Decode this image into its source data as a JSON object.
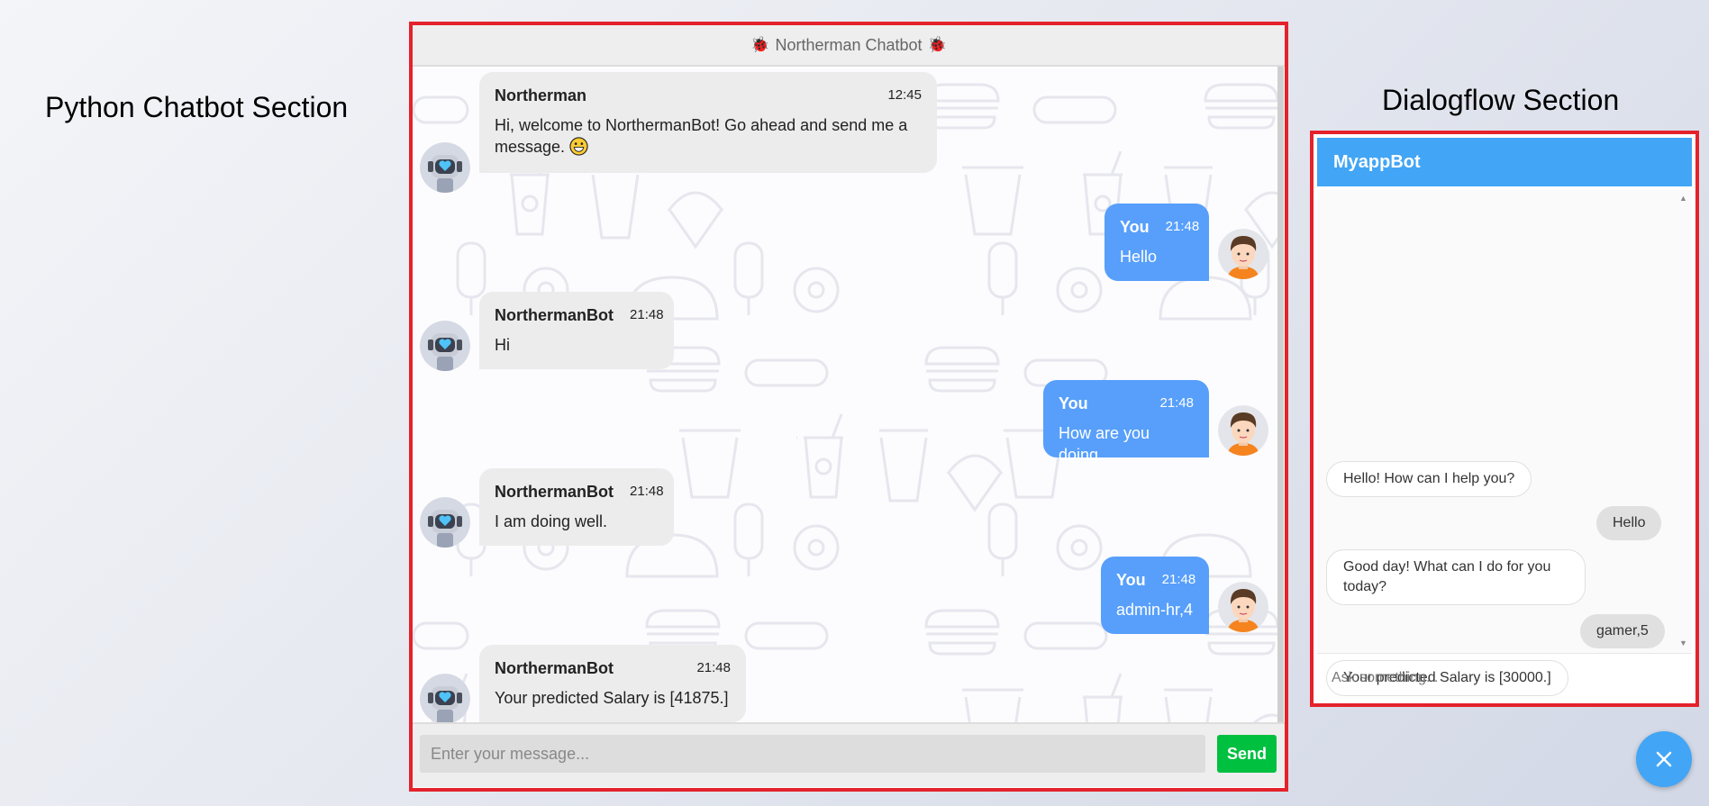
{
  "sections": {
    "python_title": "Python Chatbot Section",
    "dialogflow_title": "Dialogflow Section"
  },
  "python_chat": {
    "header_title": "Northerman Chatbot",
    "header_icon": "bug-icon",
    "messages": [
      {
        "side": "left",
        "name": "Northerman",
        "time": "12:45",
        "text": "Hi, welcome to NorthermanBot! Go ahead and send me a message.",
        "emoji": "grinning-face"
      },
      {
        "side": "right",
        "name": "You",
        "time": "21:48",
        "text": "Hello"
      },
      {
        "side": "left",
        "name": "NorthermanBot",
        "time": "21:48",
        "text": "Hi"
      },
      {
        "side": "right",
        "name": "You",
        "time": "21:48",
        "text": "How are you doing"
      },
      {
        "side": "left",
        "name": "NorthermanBot",
        "time": "21:48",
        "text": "I am doing well."
      },
      {
        "side": "right",
        "name": "You",
        "time": "21:48",
        "text": "admin-hr,4"
      },
      {
        "side": "left",
        "name": "NorthermanBot",
        "time": "21:48",
        "text": "Your predicted Salary is [41875.]"
      }
    ],
    "input_placeholder": "Enter your message...",
    "send_label": "Send"
  },
  "dialogflow": {
    "bot_name": "MyappBot",
    "messages": [
      {
        "from": "bot",
        "text": "Hello! How can I help you?"
      },
      {
        "from": "user",
        "text": "Hello"
      },
      {
        "from": "bot",
        "text": "Good day! What can I do for you today?"
      },
      {
        "from": "user",
        "text": "gamer,5"
      },
      {
        "from": "bot",
        "text": "Your predicted Salary is [30000.]"
      }
    ],
    "input_placeholder": "Ask something...",
    "fab_icon": "close-icon"
  },
  "colors": {
    "frame_border": "#e4222b",
    "user_bubble": "#579ffb",
    "send_button": "#00c040",
    "dialogflow_accent": "#42a5f5"
  }
}
